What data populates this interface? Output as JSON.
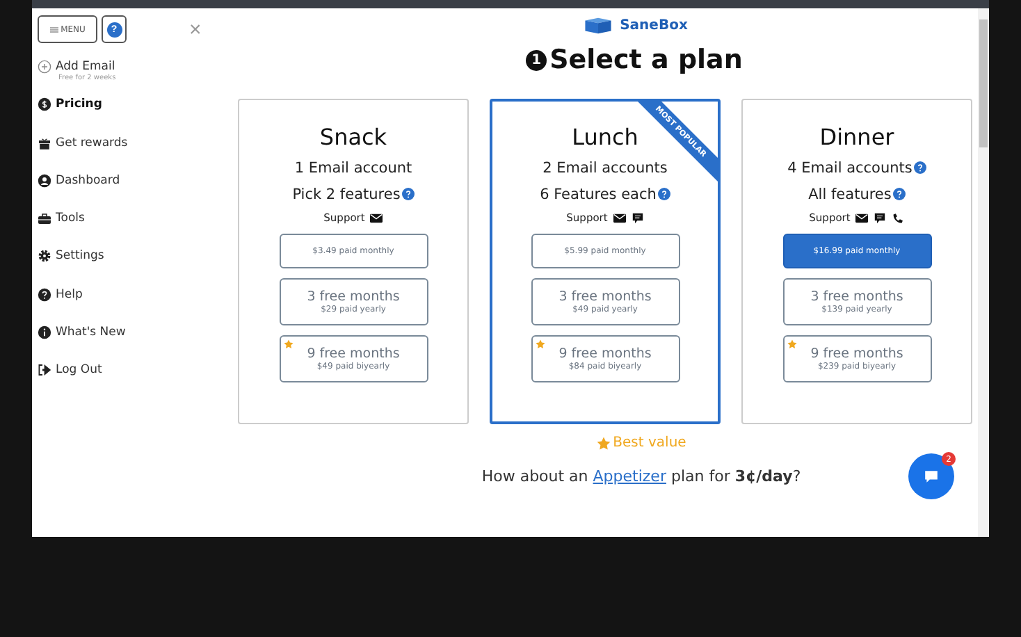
{
  "sidebar": {
    "menu_button": "MENU",
    "help_button": "?",
    "close": "×",
    "items": [
      {
        "label": "Add Email",
        "sublabel": "Free for 2 weeks",
        "kind": "plus",
        "selected": false
      },
      {
        "label": "Pricing",
        "kind": "dollar",
        "selected": true
      },
      {
        "label": "Get rewards",
        "kind": "gift",
        "selected": false
      },
      {
        "label": "Dashboard",
        "kind": "user",
        "selected": false
      },
      {
        "label": "Tools",
        "kind": "toolbox",
        "selected": false
      },
      {
        "label": "Settings",
        "kind": "gear",
        "selected": false
      },
      {
        "label": "Help",
        "kind": "question",
        "selected": false
      },
      {
        "label": "What's New",
        "kind": "info",
        "selected": false
      },
      {
        "label": "Log Out",
        "kind": "logout",
        "selected": false
      }
    ]
  },
  "brand": "SaneBox",
  "heading": {
    "step": "1",
    "title": "Select a plan"
  },
  "plans": [
    {
      "name": "Snack",
      "highlighted": false,
      "features": [
        {
          "text": "1 Email account",
          "help": false
        },
        {
          "text": "Pick 2 features",
          "help": true
        }
      ],
      "support": {
        "label": "Support",
        "icons": [
          {
            "kind": "mail"
          }
        ]
      },
      "options": [
        {
          "price": "$3.49 paid monthly",
          "starred": false,
          "selected": false
        },
        {
          "title": "3 free months",
          "price": "$29 paid yearly",
          "starred": false,
          "selected": false
        },
        {
          "title": "9 free months",
          "price": "$49 paid biyearly",
          "starred": true,
          "selected": false
        }
      ]
    },
    {
      "name": "Lunch",
      "highlighted": true,
      "ribbon": "MOST POPULAR",
      "features": [
        {
          "text": "2 Email accounts",
          "help": false
        },
        {
          "text": "6 Features each",
          "help": true
        }
      ],
      "support": {
        "label": "Support",
        "icons": [
          {
            "kind": "mail"
          },
          {
            "kind": "chat"
          }
        ]
      },
      "options": [
        {
          "price": "$5.99 paid monthly",
          "starred": false,
          "selected": false
        },
        {
          "title": "3 free months",
          "price": "$49 paid yearly",
          "starred": false,
          "selected": false
        },
        {
          "title": "9 free months",
          "price": "$84 paid biyearly",
          "starred": true,
          "selected": false
        }
      ]
    },
    {
      "name": "Dinner",
      "highlighted": false,
      "features": [
        {
          "text": "4 Email accounts",
          "help": true
        },
        {
          "text": "All features",
          "help": true
        }
      ],
      "support": {
        "label": "Support",
        "icons": [
          {
            "kind": "mail"
          },
          {
            "kind": "chat"
          },
          {
            "kind": "phone"
          }
        ]
      },
      "options": [
        {
          "price": "$16.99 paid monthly",
          "starred": false,
          "selected": true
        },
        {
          "title": "3 free months",
          "price": "$139 paid yearly",
          "starred": false,
          "selected": false
        },
        {
          "title": "9 free months",
          "price": "$239 paid biyearly",
          "starred": true,
          "selected": false
        }
      ]
    }
  ],
  "best_value": "Best value",
  "offer": {
    "before": "How about an ",
    "link": "Appetizer",
    "after": " plan for **3¢/day**?"
  },
  "chat": {
    "badge": "2"
  }
}
